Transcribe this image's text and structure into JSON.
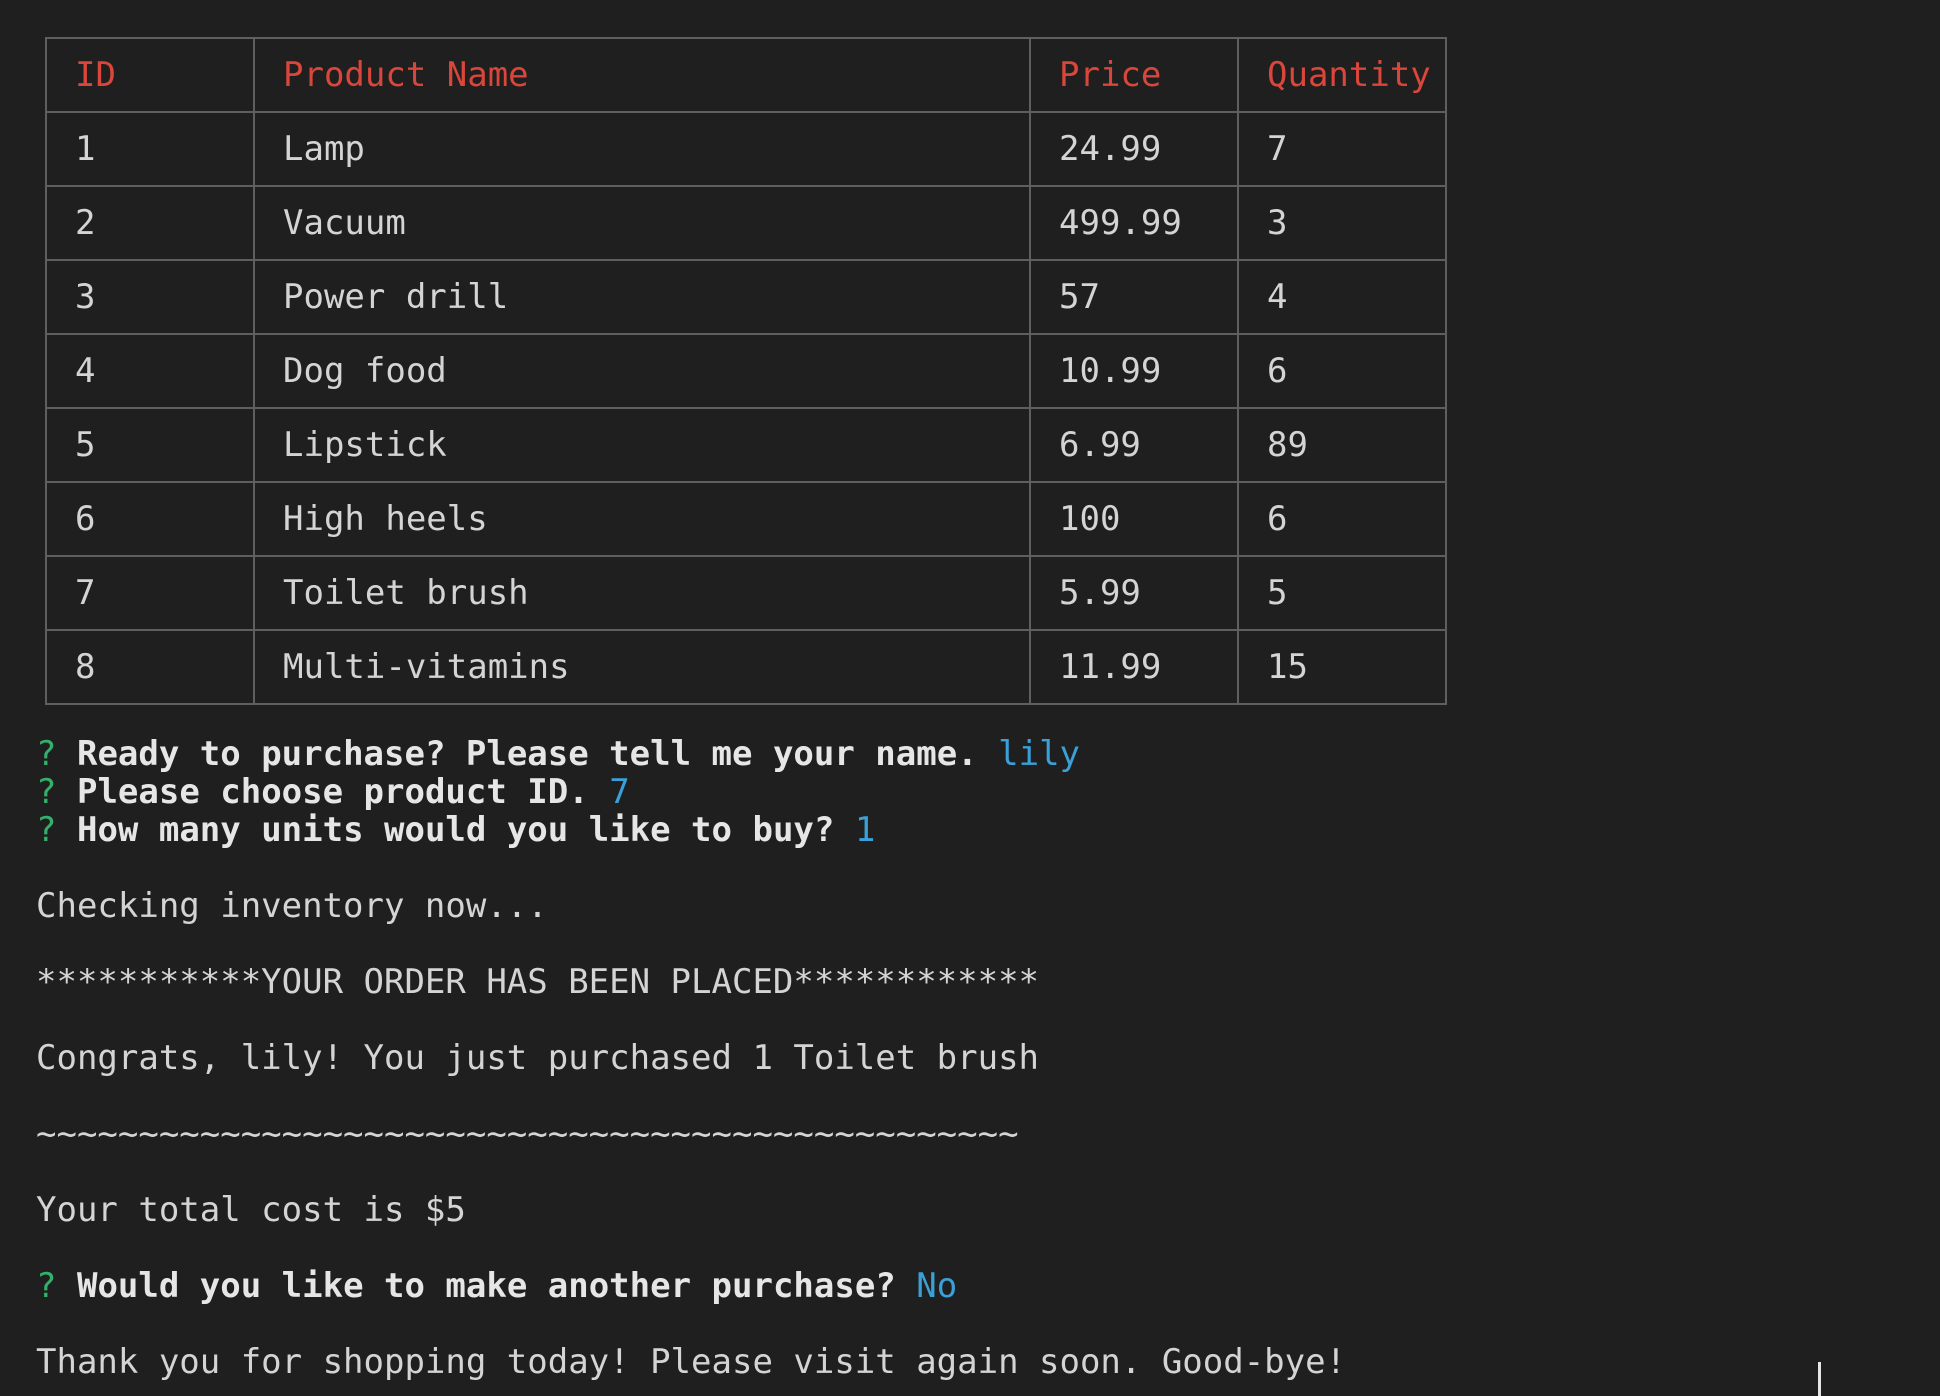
{
  "table": {
    "headers": [
      "ID",
      "Product Name",
      "Price",
      "Quantity"
    ],
    "rows": [
      [
        "1",
        "Lamp",
        "24.99",
        "7"
      ],
      [
        "2",
        "Vacuum",
        "499.99",
        "3"
      ],
      [
        "3",
        "Power drill",
        "57",
        "4"
      ],
      [
        "4",
        "Dog food",
        "10.99",
        "6"
      ],
      [
        "5",
        "Lipstick",
        "6.99",
        "89"
      ],
      [
        "6",
        "High heels",
        "100",
        "6"
      ],
      [
        "7",
        "Toilet brush",
        "5.99",
        "5"
      ],
      [
        "8",
        "Multi-vitamins",
        "11.99",
        "15"
      ]
    ]
  },
  "prompts": [
    {
      "mark": "?",
      "question": "Ready to purchase? Please tell me your name.",
      "answer": "lily"
    },
    {
      "mark": "?",
      "question": "Please choose product ID.",
      "answer": "7"
    },
    {
      "mark": "?",
      "question": "How many units would you like to buy?",
      "answer": "1"
    }
  ],
  "output": {
    "checking": "Checking inventory now...",
    "order_placed": "***********YOUR ORDER HAS BEEN PLACED************",
    "congrats": "Congrats, lily! You just purchased 1 Toilet brush",
    "divider": "~~~~~~~~~~~~~~~~~~~~~~~~~~~~~~~~~~~~~~~~~~~~~~~~",
    "total": "Your total cost is $5",
    "goodbye": "Thank you for shopping today! Please visit again soon. Good-bye!"
  },
  "another_prompt": {
    "mark": "?",
    "question": "Would you like to make another purchase?",
    "answer": "No"
  },
  "colors": {
    "background": "#1f1f1f",
    "header_text": "#d9463b",
    "question_mark": "#33b06b",
    "answer_text": "#3aa0d8",
    "body_text": "#d4d4d4"
  }
}
